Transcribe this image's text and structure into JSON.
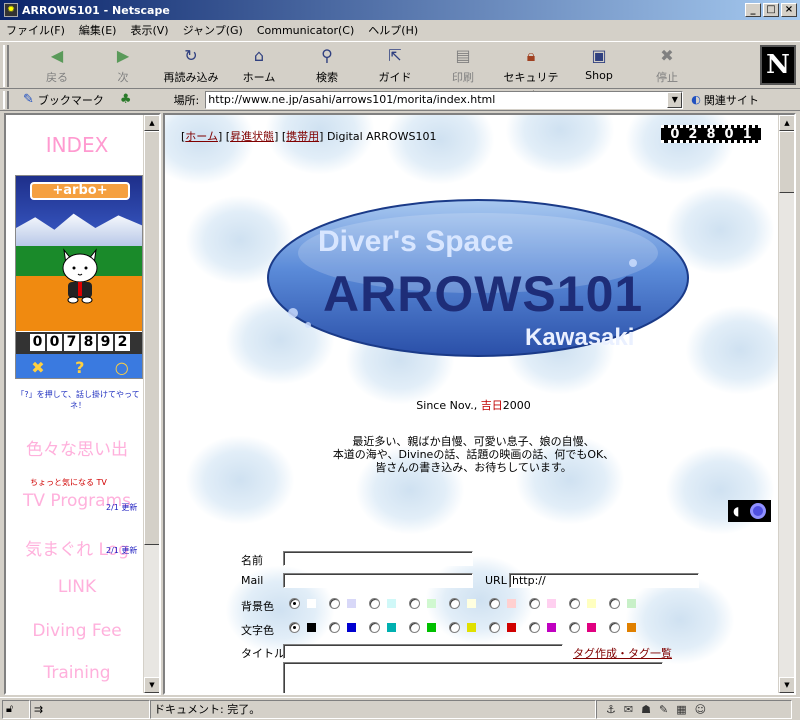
{
  "window": {
    "title": "ARROWS101 - Netscape"
  },
  "menu": [
    "ファイル(F)",
    "編集(E)",
    "表示(V)",
    "ジャンプ(G)",
    "Communicator(C)",
    "ヘルプ(H)"
  ],
  "toolbar": {
    "items": [
      {
        "label": "戻る",
        "icon": "back-arrow-icon",
        "glyph": "◀",
        "disabled": true
      },
      {
        "label": "次",
        "icon": "forward-arrow-icon",
        "glyph": "▶",
        "disabled": true
      },
      {
        "label": "再読み込み",
        "icon": "reload-icon",
        "glyph": "↻",
        "disabled": false
      },
      {
        "label": "ホーム",
        "icon": "home-icon",
        "glyph": "⌂",
        "disabled": false
      },
      {
        "label": "検索",
        "icon": "search-icon",
        "glyph": "🔍",
        "disabled": false
      },
      {
        "label": "ガイド",
        "icon": "guide-icon",
        "glyph": "↗",
        "disabled": false
      },
      {
        "label": "印刷",
        "icon": "print-icon",
        "glyph": "▤",
        "disabled": true
      },
      {
        "label": "セキュリティ",
        "icon": "security-lock-icon",
        "glyph": "🔒",
        "disabled": false
      },
      {
        "label": "Shop",
        "icon": "shop-icon",
        "glyph": "▣",
        "disabled": false
      },
      {
        "label": "停止",
        "icon": "stop-icon",
        "glyph": "✖",
        "disabled": true
      }
    ],
    "logo": "N"
  },
  "location": {
    "bookmark_label": "ブックマーク",
    "location_label": "場所:",
    "url": "http://www.ne.jp/asahi/arrows101/morita/index.html",
    "related_label": "関連サイト"
  },
  "left_frame": {
    "index_title": "INDEX",
    "tarbo": {
      "logo": "+arbo+",
      "counter": [
        "0",
        "0",
        "7",
        "8",
        "9",
        "2"
      ],
      "buttons": [
        "✖",
        "?",
        "○"
      ]
    },
    "note": "「?」を押して、話し掛けてやってネ！",
    "links": [
      {
        "label": "色々な思い出"
      },
      {
        "label": "TV Programs"
      },
      {
        "label": "気まぐれ Log"
      },
      {
        "label": "LINK"
      },
      {
        "label": "Diving Fee"
      },
      {
        "label": "Training"
      }
    ],
    "small_tv": "ちょっと気になる TV",
    "update1": "2/1 更新",
    "update2": "2/1 更新"
  },
  "main": {
    "nav": {
      "home": "ホーム",
      "status": "昇進状態",
      "mobile": "携帯用",
      "suffix": " Digital ARROWS101"
    },
    "counter": [
      "0",
      "2",
      "8",
      "0",
      "1"
    ],
    "badge": {
      "line1": "Diver's Space",
      "line2": "ARROWS101",
      "line3": "Kawasaki"
    },
    "since": {
      "prefix": "Since  Nov.",
      "red": "吉日",
      "suffix": "2000"
    },
    "intro": [
      "最近多い、親ばか自慢、可愛い息子、娘の自慢、",
      "本道の海や、Divineの話、話題の映画の話、何でもOK、",
      "皆さんの書き込み、お待ちしています。"
    ],
    "form": {
      "name_label": "名前",
      "mail_label": "Mail",
      "url_label": "URL",
      "url_value": "http://",
      "bg_label": "背景色",
      "text_label": "文字色",
      "title_label": "タイトル",
      "tag_link": "タグ作成・タグ一覧",
      "bg_colors": [
        "#ffffff",
        "#d8d8f8",
        "#d0f8f8",
        "#d0f8d0",
        "#ffffe0",
        "#ffd0d0",
        "#ffd0f0",
        "#ffffc0",
        "#c8f0c8"
      ],
      "text_colors": [
        "#000000",
        "#0000d0",
        "#00b0b0",
        "#00c000",
        "#e0e000",
        "#d00000",
        "#c000c0",
        "#e00080",
        "#e08000"
      ]
    }
  },
  "status": {
    "text": "ドキュメント: 完了。"
  }
}
